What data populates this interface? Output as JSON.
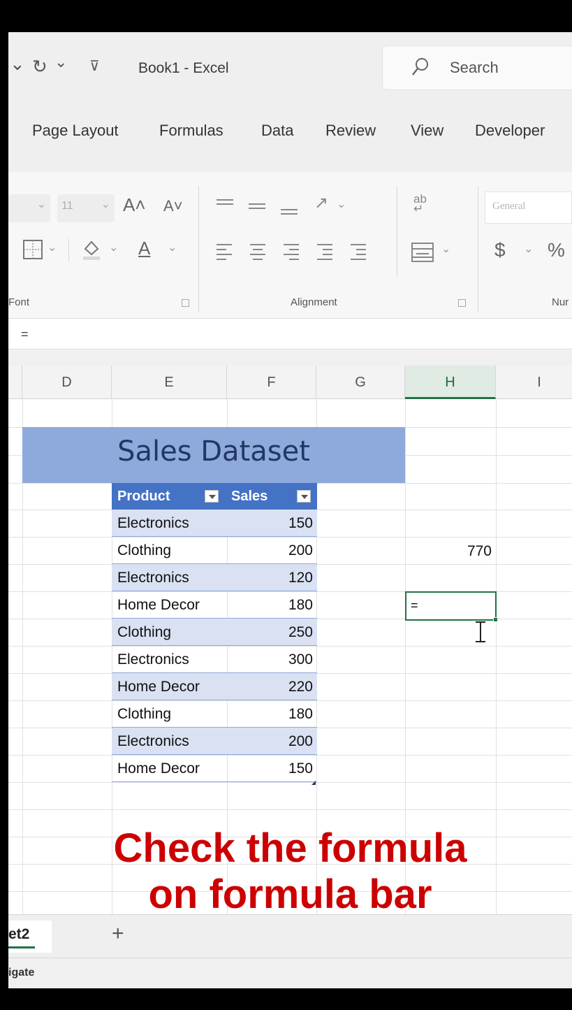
{
  "titlebar": {
    "undo_glyph": "⌄",
    "redo_glyph": "↻",
    "redo_chevron": "⌄",
    "qat_glyph": "⊽",
    "doc_title": "Book1 - Excel",
    "search_placeholder": "Search"
  },
  "menu": {
    "items": [
      "Page Layout",
      "Formulas",
      "Data",
      "Review",
      "View",
      "Developer"
    ]
  },
  "ribbon": {
    "font": {
      "size_value": "11",
      "grow_label": "A˄",
      "shrink_label": "A˅",
      "font_color_label": "A",
      "group_label": "Font"
    },
    "alignment": {
      "orientation_label": "ab",
      "group_label": "Alignment"
    },
    "number": {
      "format_value": "General",
      "currency_label": "$",
      "percent_label": "%",
      "group_label": "Nur"
    }
  },
  "formula_bar": {
    "content": "="
  },
  "columns": [
    "D",
    "E",
    "F",
    "G",
    "H",
    "I"
  ],
  "sheet": {
    "title": "Sales Dataset",
    "headers": [
      "Product",
      "Sales"
    ],
    "rows": [
      {
        "product": "Electronics",
        "sales": "150"
      },
      {
        "product": "Clothing",
        "sales": "200"
      },
      {
        "product": "Electronics",
        "sales": "120"
      },
      {
        "product": "Home Decor",
        "sales": "180"
      },
      {
        "product": "Clothing",
        "sales": "250"
      },
      {
        "product": "Electronics",
        "sales": "300"
      },
      {
        "product": "Home Decor",
        "sales": "220"
      },
      {
        "product": "Clothing",
        "sales": "180"
      },
      {
        "product": "Electronics",
        "sales": "200"
      },
      {
        "product": "Home Decor",
        "sales": "150"
      }
    ],
    "h_value": "770",
    "active_cell_content": "="
  },
  "overlay": {
    "line1": "Check the formula",
    "line2": "on formula bar"
  },
  "tabs": {
    "sheet_name": "et2",
    "add_label": "+"
  },
  "status": {
    "text": "igate"
  },
  "colors": {
    "excel_green": "#217346",
    "table_header": "#4472c4",
    "table_band": "#d9e1f2",
    "title_band": "#8ea9db",
    "overlay_red": "#cc0000"
  }
}
